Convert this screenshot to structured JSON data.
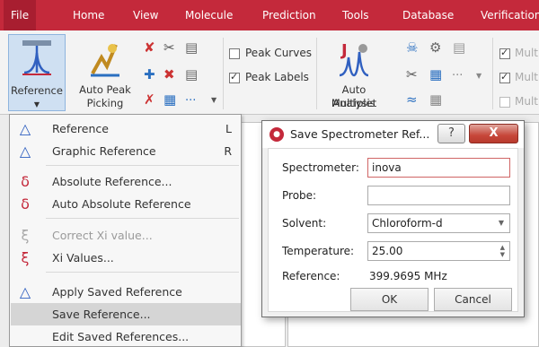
{
  "menubar": {
    "items": [
      "File",
      "Home",
      "View",
      "Molecule",
      "Prediction",
      "Tools",
      "Database",
      "Verification"
    ]
  },
  "ribbon": {
    "reference_button": "Reference",
    "auto_peak_line1": "Auto Peak",
    "auto_peak_line2": "Picking",
    "peak_curves": "Peak Curves",
    "peak_labels": "Peak Labels",
    "auto_multiplet_line1": "Auto Multiplet",
    "auto_multiplet_line2": "Analysis",
    "mult_label_1": "Mult",
    "mult_label_2": "Mult",
    "mult_label_3": "Mult",
    "more": "...",
    "peak_curves_checked": false,
    "peak_labels_checked": true
  },
  "menu": {
    "items": [
      {
        "label": "Reference",
        "shortcut": "L",
        "disabled": false,
        "hover": false
      },
      {
        "label": "Graphic Reference",
        "shortcut": "R",
        "disabled": false,
        "hover": false
      },
      {
        "label": "Absolute Reference...",
        "shortcut": "",
        "disabled": false,
        "hover": false
      },
      {
        "label": "Auto Absolute Reference",
        "shortcut": "",
        "disabled": false,
        "hover": false
      },
      {
        "label": "Correct Xi value...",
        "shortcut": "",
        "disabled": true,
        "hover": false
      },
      {
        "label": "Xi Values...",
        "shortcut": "",
        "disabled": false,
        "hover": false
      },
      {
        "label": "Apply Saved Reference",
        "shortcut": "",
        "disabled": false,
        "hover": false
      },
      {
        "label": "Save Reference...",
        "shortcut": "",
        "disabled": false,
        "hover": true
      },
      {
        "label": "Edit Saved References...",
        "shortcut": "",
        "disabled": false,
        "hover": false
      }
    ]
  },
  "dialog": {
    "title": "Save Spectrometer Ref...",
    "help": "?",
    "close": "X",
    "spectrometer_label": "Spectrometer:",
    "spectrometer_value": "inova",
    "probe_label": "Probe:",
    "probe_value": "",
    "solvent_label": "Solvent:",
    "solvent_value": "Chloroform-d",
    "temperature_label": "Temperature:",
    "temperature_value": "25.00",
    "reference_label": "Reference:",
    "reference_value": "399.9695 MHz",
    "ok": "OK",
    "cancel": "Cancel"
  },
  "colors": {
    "brand": "#c4293b",
    "menu_hover": "#d5d5d5",
    "close_button": "#c7473a"
  }
}
